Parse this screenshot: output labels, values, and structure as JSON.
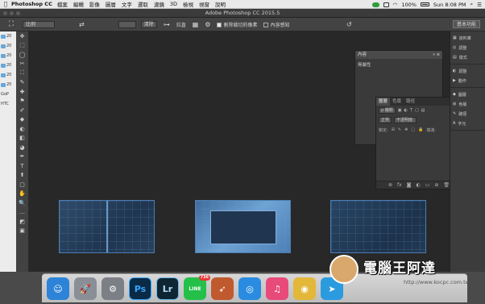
{
  "menubar": {
    "apple": "",
    "app_name": "Photoshop CC",
    "items": [
      "檔案",
      "編輯",
      "影像",
      "圖層",
      "文字",
      "選取",
      "濾鏡",
      "3D",
      "檢視",
      "視窗",
      "說明"
    ],
    "battery": "100%",
    "clock": "Sun 8:08 PM",
    "status_icons": [
      "creative-cloud-icon",
      "wifi-icon",
      "battery-icon",
      "search-icon",
      "list-icon"
    ]
  },
  "titlebar": {
    "title": "Adobe Photoshop CC 2015.5"
  },
  "options": {
    "ratio_label": "比例",
    "swap_icon": "⇄",
    "clear_label": "清除",
    "straighten_label": "拉直",
    "delete_cropped_label": "刪除裁切的像素",
    "content_aware_label": "內容感知",
    "workspace_label": "基本功能"
  },
  "finder": {
    "rows": [
      "20",
      "20",
      "20",
      "20",
      "20",
      "20",
      "GoP",
      "HTC"
    ]
  },
  "tools": [
    "✥",
    "⬚",
    "◯",
    "✂",
    "⛶",
    "✎",
    "✚",
    "⚑",
    "✐",
    "◆",
    "◐",
    "◧",
    "◕",
    "✒",
    "T",
    "⬆",
    "▢",
    "✋",
    "🔍",
    "…",
    "◩",
    "▣"
  ],
  "properties": {
    "title": "內容",
    "sub": "無屬性"
  },
  "layers": {
    "tabs": [
      "圖層",
      "色版",
      "路徑"
    ],
    "kind_label": "ρ 種類",
    "blend_mode": "正常",
    "opacity_label": "不透明度:",
    "lock_label": "鎖定:",
    "fill_label": "填滿:",
    "footer_icons": [
      "link-icon",
      "fx-icon",
      "mask-icon",
      "adjustment-icon",
      "folder-icon",
      "new-layer-icon",
      "trash-icon"
    ]
  },
  "rdock": [
    {
      "label": "資料庫",
      "icon": "library-icon"
    },
    {
      "label": "調整",
      "icon": "adjust-icon"
    },
    {
      "label": "樣式",
      "icon": "style-icon"
    },
    {
      "label": "調整",
      "icon": "adjust2-icon"
    },
    {
      "label": "動作",
      "icon": "actions-icon"
    },
    {
      "label": "圖層",
      "icon": "layers-icon"
    },
    {
      "label": "色版",
      "icon": "channels-icon"
    },
    {
      "label": "路徑",
      "icon": "paths-icon"
    },
    {
      "label": "字元",
      "icon": "character-icon"
    }
  ],
  "dock": [
    {
      "name": "finder",
      "label": "",
      "color": "#2d83d8"
    },
    {
      "name": "launchpad",
      "label": "",
      "color": "#8a8f97"
    },
    {
      "name": "system-prefs",
      "label": "",
      "color": "#7c7f86"
    },
    {
      "name": "photoshop",
      "label": "Ps",
      "color": "#0a2a46"
    },
    {
      "name": "lightroom",
      "label": "Lr",
      "color": "#0e2533"
    },
    {
      "name": "line",
      "label": "LINE",
      "color": "#25c049",
      "badge": "736"
    },
    {
      "name": "rocket",
      "label": "",
      "color": "#c05a2e"
    },
    {
      "name": "safari",
      "label": "",
      "color": "#2a8ce0"
    },
    {
      "name": "itunes",
      "label": "",
      "color": "#e84a7a"
    },
    {
      "name": "chrome",
      "label": "",
      "color": "#e3b73a"
    },
    {
      "name": "telegram",
      "label": "",
      "color": "#2b9be0"
    }
  ],
  "watermark": {
    "text": "電腦王阿達",
    "url": "http://www.kocpc.com.tw"
  }
}
